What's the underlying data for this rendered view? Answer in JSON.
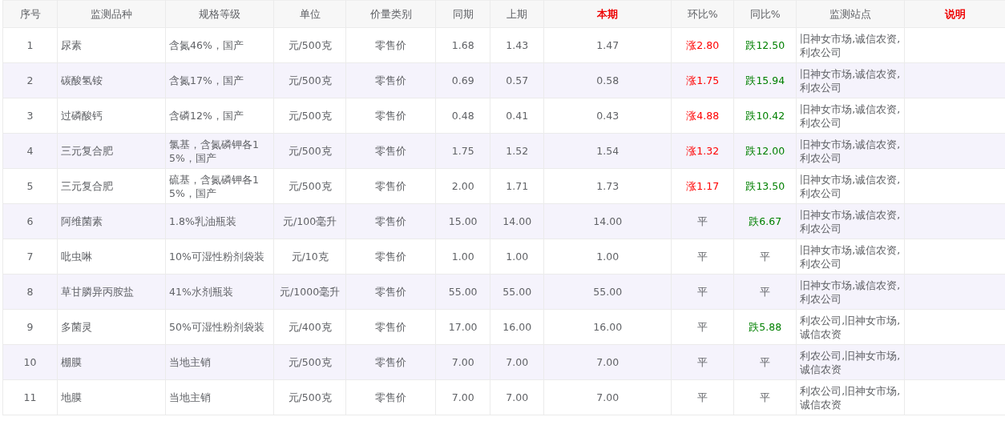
{
  "table": {
    "columns": [
      {
        "label": "序号",
        "highlight": false
      },
      {
        "label": "监测品种",
        "highlight": false
      },
      {
        "label": "规格等级",
        "highlight": false
      },
      {
        "label": "单位",
        "highlight": false
      },
      {
        "label": "价量类别",
        "highlight": false
      },
      {
        "label": "同期",
        "highlight": false
      },
      {
        "label": "上期",
        "highlight": false
      },
      {
        "label": "本期",
        "highlight": true
      },
      {
        "label": "环比%",
        "highlight": false
      },
      {
        "label": "同比%",
        "highlight": false
      },
      {
        "label": "监测站点",
        "highlight": false
      },
      {
        "label": "说明",
        "highlight": true
      }
    ],
    "rows": [
      {
        "no": "1",
        "name": "尿素",
        "spec": "含氮46%，国产",
        "unit": "元/500克",
        "category": "零售价",
        "same_period": "1.68",
        "last_period": "1.43",
        "current": "1.47",
        "mom": {
          "kind": "up",
          "text": "涨2.80"
        },
        "yoy": {
          "kind": "down",
          "text": "跌12.50"
        },
        "stations": "旧神女市场,诚信农资,利农公司"
      },
      {
        "no": "2",
        "name": "碳酸氢铵",
        "spec": "含氮17%，国产",
        "unit": "元/500克",
        "category": "零售价",
        "same_period": "0.69",
        "last_period": "0.57",
        "current": "0.58",
        "mom": {
          "kind": "up",
          "text": "涨1.75"
        },
        "yoy": {
          "kind": "down",
          "text": "跌15.94"
        },
        "stations": "旧神女市场,诚信农资,利农公司"
      },
      {
        "no": "3",
        "name": "过磷酸钙",
        "spec": "含磷12%，国产",
        "unit": "元/500克",
        "category": "零售价",
        "same_period": "0.48",
        "last_period": "0.41",
        "current": "0.43",
        "mom": {
          "kind": "up",
          "text": "涨4.88"
        },
        "yoy": {
          "kind": "down",
          "text": "跌10.42"
        },
        "stations": "旧神女市场,诚信农资,利农公司"
      },
      {
        "no": "4",
        "name": "三元复合肥",
        "spec": "氯基，含氮磷钾各15%，国产",
        "unit": "元/500克",
        "category": "零售价",
        "same_period": "1.75",
        "last_period": "1.52",
        "current": "1.54",
        "mom": {
          "kind": "up",
          "text": "涨1.32"
        },
        "yoy": {
          "kind": "down",
          "text": "跌12.00"
        },
        "stations": "旧神女市场,诚信农资,利农公司"
      },
      {
        "no": "5",
        "name": "三元复合肥",
        "spec": "硫基，含氮磷钾各15%，国产",
        "unit": "元/500克",
        "category": "零售价",
        "same_period": "2.00",
        "last_period": "1.71",
        "current": "1.73",
        "mom": {
          "kind": "up",
          "text": "涨1.17"
        },
        "yoy": {
          "kind": "down",
          "text": "跌13.50"
        },
        "stations": "旧神女市场,诚信农资,利农公司"
      },
      {
        "no": "6",
        "name": "阿维菌素",
        "spec": "1.8%乳油瓶装",
        "unit": "元/100毫升",
        "category": "零售价",
        "same_period": "15.00",
        "last_period": "14.00",
        "current": "14.00",
        "mom": {
          "kind": "flat",
          "text": "平"
        },
        "yoy": {
          "kind": "down",
          "text": "跌6.67"
        },
        "stations": "旧神女市场,诚信农资,利农公司"
      },
      {
        "no": "7",
        "name": "吡虫啉",
        "spec": "10%可湿性粉剂袋装",
        "unit": "元/10克",
        "category": "零售价",
        "same_period": "1.00",
        "last_period": "1.00",
        "current": "1.00",
        "mom": {
          "kind": "flat",
          "text": "平"
        },
        "yoy": {
          "kind": "flat",
          "text": "平"
        },
        "stations": "旧神女市场,诚信农资,利农公司"
      },
      {
        "no": "8",
        "name": "草甘膦异丙胺盐",
        "spec": "41%水剂瓶装",
        "unit": "元/1000毫升",
        "category": "零售价",
        "same_period": "55.00",
        "last_period": "55.00",
        "current": "55.00",
        "mom": {
          "kind": "flat",
          "text": "平"
        },
        "yoy": {
          "kind": "flat",
          "text": "平"
        },
        "stations": "旧神女市场,诚信农资,利农公司"
      },
      {
        "no": "9",
        "name": "多菌灵",
        "spec": "50%可湿性粉剂袋装",
        "unit": "元/400克",
        "category": "零售价",
        "same_period": "17.00",
        "last_period": "16.00",
        "current": "16.00",
        "mom": {
          "kind": "flat",
          "text": "平"
        },
        "yoy": {
          "kind": "down",
          "text": "跌5.88"
        },
        "stations": "利农公司,旧神女市场,诚信农资"
      },
      {
        "no": "10",
        "name": "棚膜",
        "spec": "当地主销",
        "unit": "元/500克",
        "category": "零售价",
        "same_period": "7.00",
        "last_period": "7.00",
        "current": "7.00",
        "mom": {
          "kind": "flat",
          "text": "平"
        },
        "yoy": {
          "kind": "flat",
          "text": "平"
        },
        "stations": "利农公司,旧神女市场,诚信农资"
      },
      {
        "no": "11",
        "name": "地膜",
        "spec": "当地主销",
        "unit": "元/500克",
        "category": "零售价",
        "same_period": "7.00",
        "last_period": "7.00",
        "current": "7.00",
        "mom": {
          "kind": "flat",
          "text": "平"
        },
        "yoy": {
          "kind": "flat",
          "text": "平"
        },
        "stations": "利农公司,旧神女市场,诚信农资"
      }
    ]
  }
}
